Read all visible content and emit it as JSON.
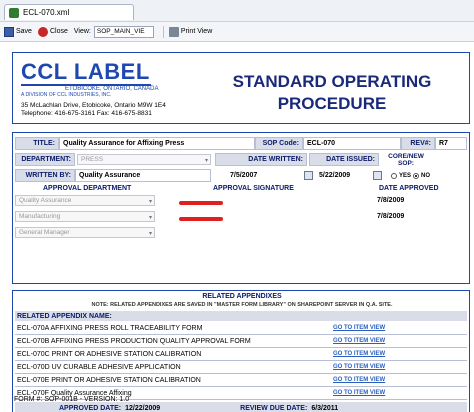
{
  "tab": {
    "title": "ECL-070.xml"
  },
  "toolbar": {
    "save_label": "Save",
    "close_label": "Close",
    "view_label": "View:",
    "view_value": "SOP_MAIN_VIE",
    "print_label": "Print View"
  },
  "header": {
    "logo_text": "CCL LABEL",
    "logo_location": "ETOBICOKE, ONTARIO, CANADA",
    "logo_division": "A DIVISION OF CCL INDUSTRIES, INC.",
    "address": "35 McLachlan Drive, Etobicoke, Ontario  M9W 1E4",
    "phone": "Telephone: 416-675-3161  Fax: 416-675-8831",
    "title_line1": "STANDARD OPERATING",
    "title_line2": "PROCEDURE"
  },
  "meta": {
    "title_label": "TITLE:",
    "title_value": "Quality Assurance for Affixing Press",
    "sop_code_label": "SOP Code:",
    "sop_code_value": "ECL-070",
    "rev_label": "REV#:",
    "rev_value": "R7",
    "department_label": "DEPARTMENT:",
    "department_value": "PRESS",
    "date_written_label": "DATE WRITTEN:",
    "date_issued_label": "DATE ISSUED:",
    "core_label": "CORE/NEW",
    "sop_label": "SOP:",
    "written_by_label": "WRITTEN BY:",
    "written_by_value": "Quality Assurance",
    "date_written_value": "7/5/2007",
    "date_issued_value": "5/22/2009",
    "yes_label": "YES",
    "no_label": "NO",
    "core_selected": "NO",
    "approval_department_label": "APPROVAL DEPARTMENT",
    "approval_signature_label": "APPROVAL SIGNATURE",
    "date_approved_label": "DATE APPROVED",
    "approvals": [
      {
        "department": "Quality Assurance",
        "date": "7/8/2009"
      },
      {
        "department": "Manufacturing",
        "date": "7/8/2009"
      },
      {
        "department": "General Manager",
        "date": ""
      }
    ]
  },
  "appendixes": {
    "title": "RELATED APPENDIXES",
    "note": "NOTE: RELATED APPENDIXES ARE SAVED IN \"MASTER FORM LIBRARY\" ON SHAREPOINT SERVER IN Q.A. SITE.",
    "header": "RELATED APPENDIX NAME:",
    "link_label": "GO TO ITEM VIEW",
    "items": [
      {
        "name": "ECL-070A AFFIXING PRESS ROLL TRACEABILITY FORM",
        "has_link": true
      },
      {
        "name": "ECL-070B  AFFIXING PRESS PRODUCTION QUALITY APPROVAL FORM",
        "has_link": true
      },
      {
        "name": "ECL-070C PRINT OR ADHESIVE STATION CALIBRATION",
        "has_link": true
      },
      {
        "name": "ECL-070D UV CURABLE ADHESIVE APPLICATION",
        "has_link": true
      },
      {
        "name": "ECL-070E PRINT OR ADHESIVE STATION CALIBRATION",
        "has_link": true
      },
      {
        "name": "ECL-070F Quality Assurance Affixing",
        "has_link": true
      }
    ],
    "approved_date_label": "APPROVED DATE:",
    "approved_date_value": "12/22/2009",
    "review_due_label": "REVIEW DUE DATE:",
    "review_due_value": "6/3/2011"
  },
  "footer": {
    "form_number": "FORM #:  SOP-001B - VERSION: 1.0"
  }
}
